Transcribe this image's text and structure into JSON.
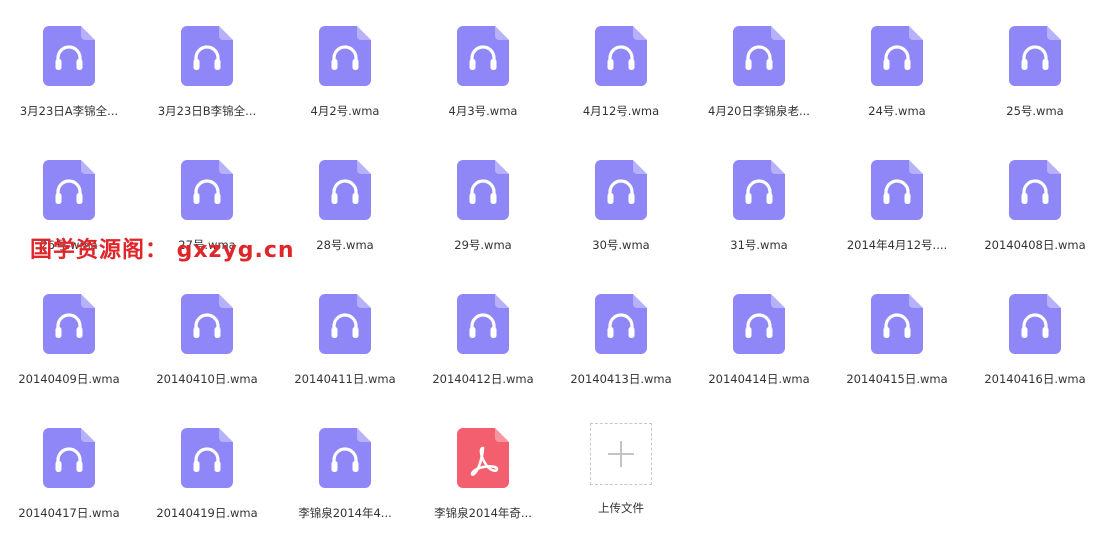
{
  "colors": {
    "audio": "#8f87f7",
    "pdf": "#f35f6e",
    "text": "#333333",
    "watermark": "#e0262a"
  },
  "files": [
    {
      "name": "3月23日A李锦全...",
      "type": "audio"
    },
    {
      "name": "3月23日B李锦全...",
      "type": "audio"
    },
    {
      "name": "4月2号.wma",
      "type": "audio"
    },
    {
      "name": "4月3号.wma",
      "type": "audio"
    },
    {
      "name": "4月12号.wma",
      "type": "audio"
    },
    {
      "name": "4月20日李锦泉老...",
      "type": "audio"
    },
    {
      "name": "24号.wma",
      "type": "audio"
    },
    {
      "name": "25号.wma",
      "type": "audio"
    },
    {
      "name": "26号.wma",
      "type": "audio"
    },
    {
      "name": "27号.wma",
      "type": "audio"
    },
    {
      "name": "28号.wma",
      "type": "audio"
    },
    {
      "name": "29号.wma",
      "type": "audio"
    },
    {
      "name": "30号.wma",
      "type": "audio"
    },
    {
      "name": "31号.wma",
      "type": "audio"
    },
    {
      "name": "2014年4月12号....",
      "type": "audio"
    },
    {
      "name": "20140408日.wma",
      "type": "audio"
    },
    {
      "name": "20140409日.wma",
      "type": "audio"
    },
    {
      "name": "20140410日.wma",
      "type": "audio"
    },
    {
      "name": "20140411日.wma",
      "type": "audio"
    },
    {
      "name": "20140412日.wma",
      "type": "audio"
    },
    {
      "name": "20140413日.wma",
      "type": "audio"
    },
    {
      "name": "20140414日.wma",
      "type": "audio"
    },
    {
      "name": "20140415日.wma",
      "type": "audio"
    },
    {
      "name": "20140416日.wma",
      "type": "audio"
    },
    {
      "name": "20140417日.wma",
      "type": "audio"
    },
    {
      "name": "20140419日.wma",
      "type": "audio"
    },
    {
      "name": "李锦泉2014年4...",
      "type": "audio"
    },
    {
      "name": "李锦泉2014年奇...",
      "type": "pdf"
    }
  ],
  "upload": {
    "label": "上传文件",
    "icon": "plus-icon"
  },
  "watermark": "国学资源阁： gxzyg.cn"
}
